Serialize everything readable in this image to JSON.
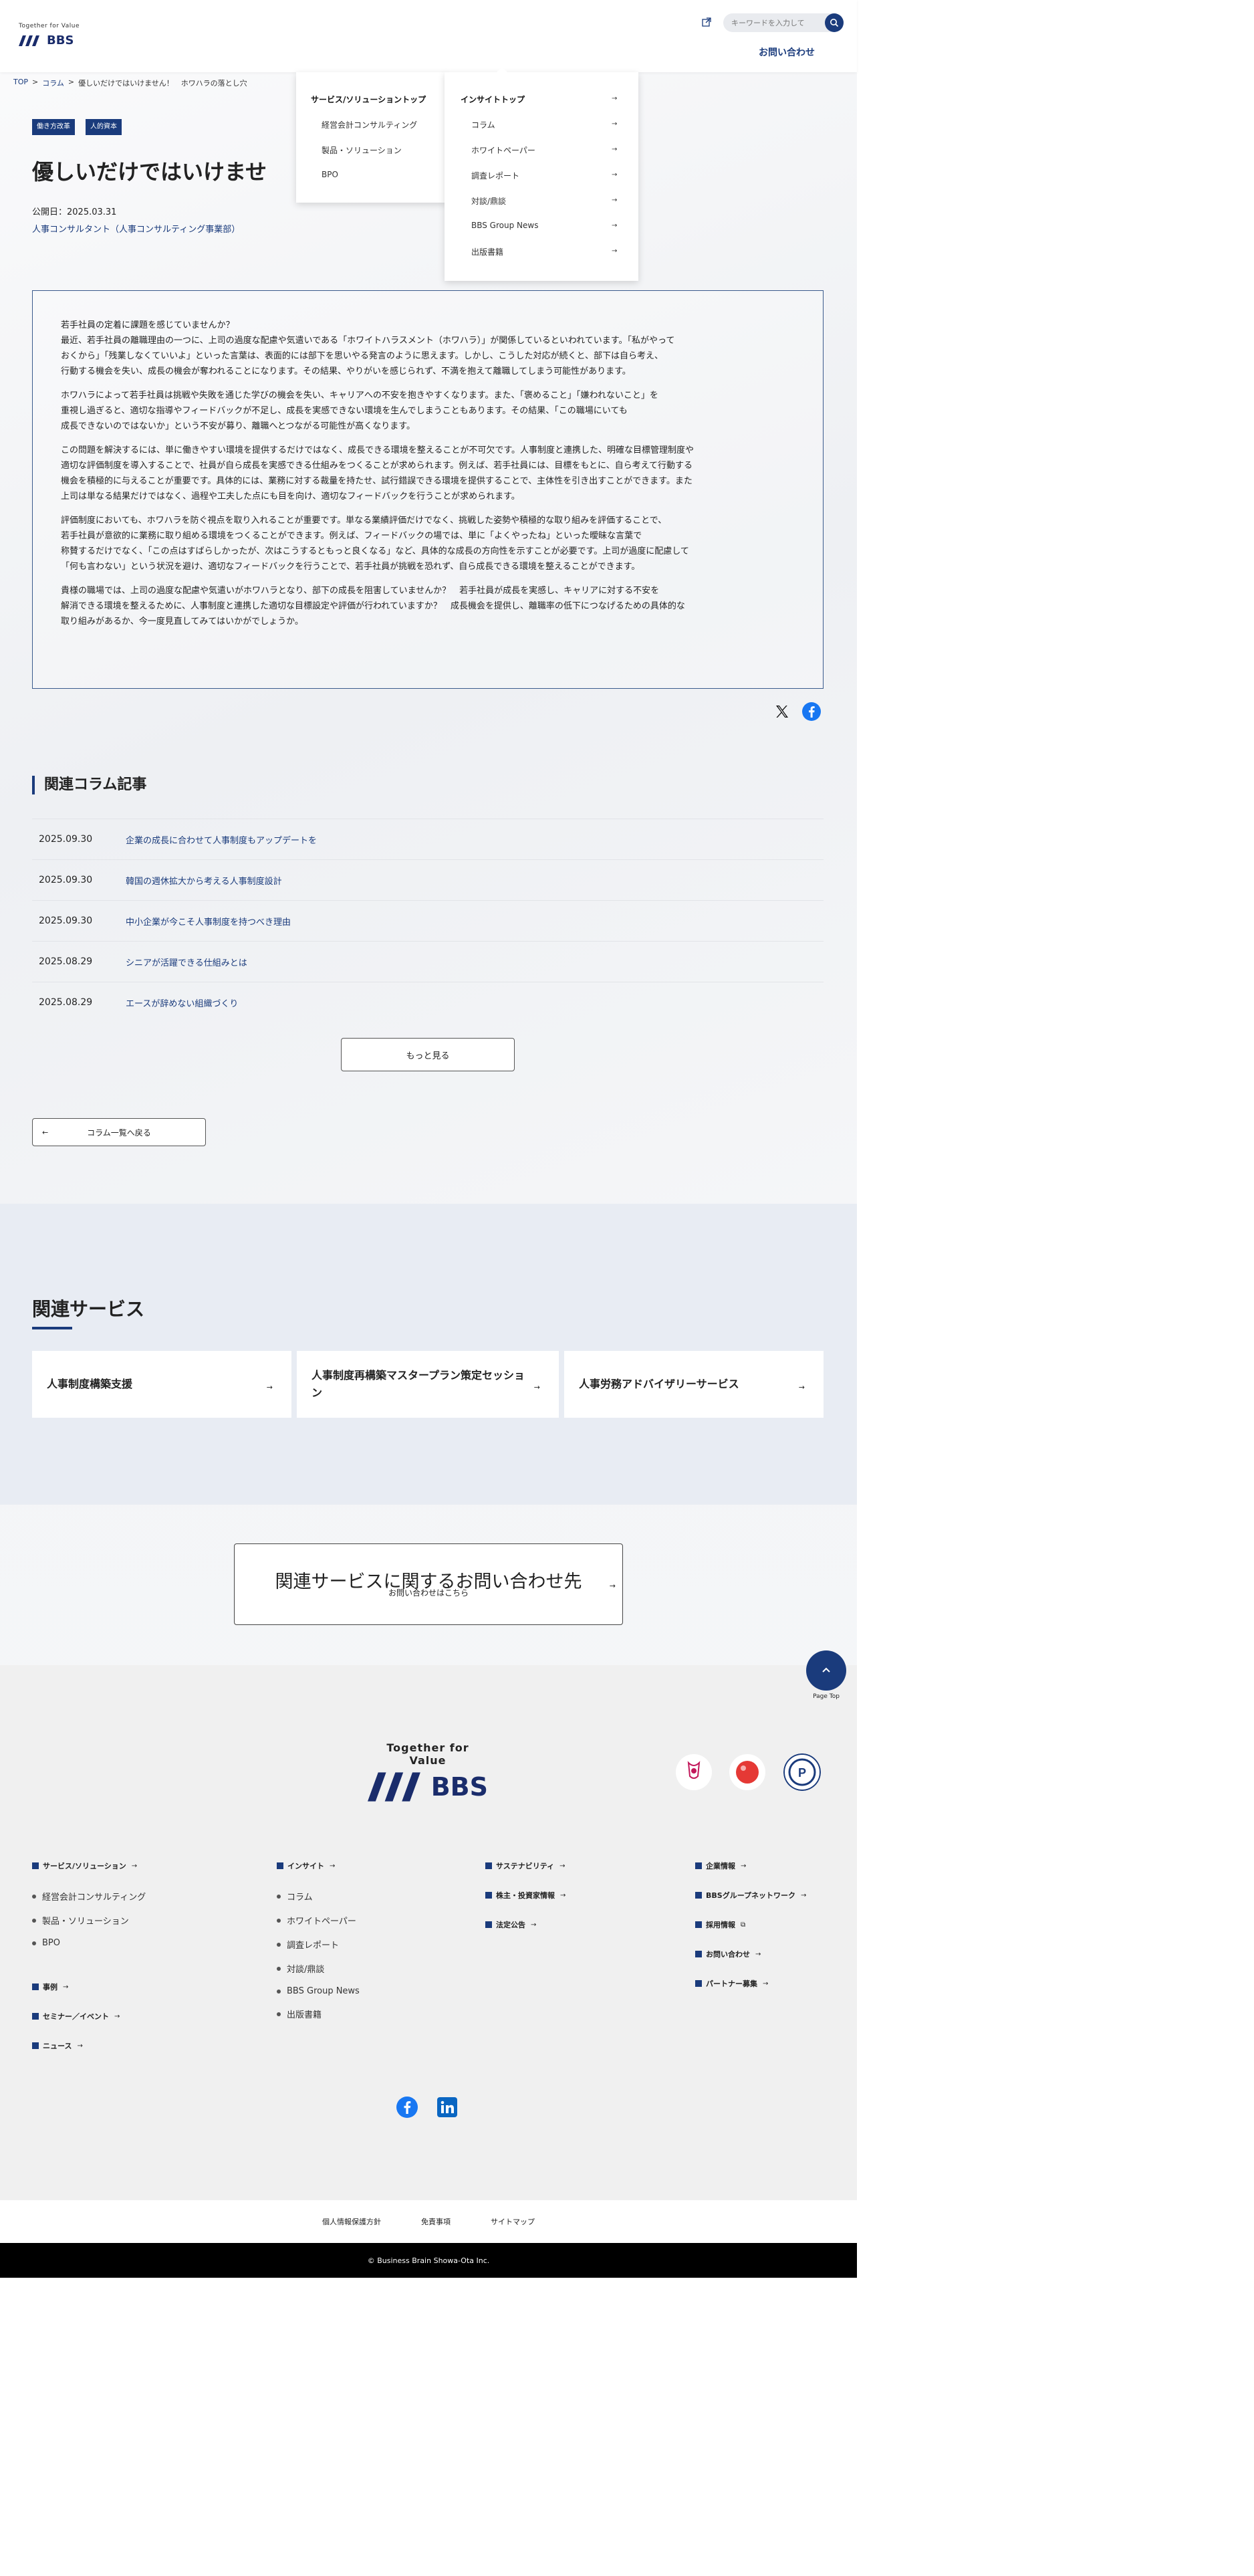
{
  "header": {
    "logo_tagline": "Together for Value",
    "logo_name": "BBS",
    "search_placeholder": "キーワードを入力して",
    "contact_label": "お問い合わせ"
  },
  "mega_menu": {
    "services": {
      "heading": "サービス/ソリューショントップ",
      "items": [
        "経営会計コンサルティング",
        "製品・ソリューション",
        "BPO"
      ]
    },
    "insight": {
      "heading": "インサイトトップ",
      "items": [
        "コラム",
        "ホワイトペーパー",
        "調査レポート",
        "対談/鼎談",
        "BBS Group News",
        "出版書籍"
      ]
    }
  },
  "breadcrumb": [
    "TOP",
    ">",
    "コラム",
    ">",
    "優しいだけではいけません！　ホワハラの落とし穴"
  ],
  "article": {
    "tags": [
      "働き方改革",
      "人的資本"
    ],
    "title": "優しいだけではいけませ",
    "published": "公開日：2025.03.31",
    "author": "人事コンサルタント（人事コンサルティング事業部）",
    "paragraphs": [
      "若手社員の定着に課題を感じていませんか？\n最近、若手社員の離職理由の一つに、上司の過度な配慮や気遣いである「ホワイトハラスメント（ホワハラ）」が関係しているといわれています。「私がやって\nおくから」「残業しなくていいよ」といった言葉は、表面的には部下を思いやる発言のように思えます。しかし、こうした対応が続くと、部下は自ら考え、\n行動する機会を失い、成長の機会が奪われることになります。その結果、やりがいを感じられず、不満を抱えて離職してしまう可能性があります。",
      "ホワハラによって若手社員は挑戦や失敗を通じた学びの機会を失い、キャリアへの不安を抱きやすくなります。また、「褒めること」「嫌われないこと」を\n重視し過ぎると、適切な指導やフィードバックが不足し、成長を実感できない環境を生んでしまうこともあります。その結果、「この職場にいても\n成長できないのではないか」という不安が募り、離職へとつながる可能性が高くなります。",
      "この問題を解決するには、単に働きやすい環境を提供するだけではなく、成長できる環境を整えることが不可欠です。人事制度と連携した、明確な目標管理制度や\n適切な評価制度を導入することで、社員が自ら成長を実感できる仕組みをつくることが求められます。例えば、若手社員には、目標をもとに、自ら考えて行動する\n機会を積極的に与えることが重要です。具体的には、業務に対する裁量を持たせ、試行錯誤できる環境を提供することで、主体性を引き出すことができます。また\n上司は単なる結果だけではなく、過程や工夫した点にも目を向け、適切なフィードバックを行うことが求められます。",
      "評価制度においても、ホワハラを防ぐ視点を取り入れることが重要です。単なる業績評価だけでなく、挑戦した姿勢や積極的な取り組みを評価することで、\n若手社員が意欲的に業務に取り組める環境をつくることができます。例えば、フィードバックの場では、単に「よくやったね」といった曖昧な言葉で\n称賛するだけでなく、「この点はすばらしかったが、次はこうするともっと良くなる」など、具体的な成長の方向性を示すことが必要です。上司が過度に配慮して\n「何も言わない」という状況を避け、適切なフィードバックを行うことで、若手社員が挑戦を恐れず、自ら成長できる環境を整えることができます。",
      "貴様の職場では、上司の過度な配慮や気遣いがホワハラとなり、部下の成長を阻害していませんか？　若手社員が成長を実感し、キャリアに対する不安を\n解消できる環境を整えるために、人事制度と連携した適切な目標設定や評価が行われていますか？　成長機会を提供し、離職率の低下につなげるための具体的な\n取り組みがあるか、今一度見直してみてはいかがでしょうか。"
    ]
  },
  "related_columns": {
    "heading": "関連コラム記事",
    "items": [
      {
        "date": "2025.09.30",
        "title": "企業の成長に合わせて人事制度もアップデートを"
      },
      {
        "date": "2025.09.30",
        "title": "韓国の週休拡大から考える人事制度設計"
      },
      {
        "date": "2025.09.30",
        "title": "中小企業が今こそ人事制度を持つべき理由"
      },
      {
        "date": "2025.08.29",
        "title": "シニアが活躍できる仕組みとは"
      },
      {
        "date": "2025.08.29",
        "title": "エースが辞めない組織づくり"
      }
    ],
    "more_label": "もっと見る",
    "back_label": "コラム一覧へ戻る"
  },
  "related_services": {
    "heading": "関連サービス",
    "cards": [
      "人事制度構築支援",
      "人事制度再構築マスタープラン策定セッション",
      "人事労務アドバイザリーサービス"
    ]
  },
  "contact_box": {
    "title": "関連サービスに関するお問い合わせ先",
    "subtitle": "お問い合わせはこちら"
  },
  "footer": {
    "pagetop_label": "Page Top",
    "tagline": "Together for Value",
    "brand": "BBS",
    "col1": {
      "heading": "サービス/ソリューション",
      "items": [
        "経営会計コンサルティング",
        "製品・ソリューション",
        "BPO"
      ],
      "extra": [
        "事例",
        "セミナー／イベント",
        "ニュース"
      ]
    },
    "col2": {
      "heading": "インサイト",
      "items": [
        "コラム",
        "ホワイトペーパー",
        "調査レポート",
        "対談/鼎談",
        "BBS Group News",
        "出版書籍"
      ]
    },
    "col3": {
      "items": [
        "サステナビリティ",
        "株主・投資家情報",
        "法定公告"
      ]
    },
    "col4": {
      "items": [
        "企業情報",
        "BBSグループネットワーク",
        "採用情報",
        "お問い合わせ",
        "パートナー募集"
      ]
    },
    "bottom_links": [
      "個人情報保護方針",
      "免責事項",
      "サイトマップ"
    ],
    "copyright": "© Business Brain Showa-Ota Inc."
  },
  "colors": {
    "brand": "#1a3b7c",
    "facebook": "#1877f2",
    "linkedin": "#0a66c2"
  }
}
